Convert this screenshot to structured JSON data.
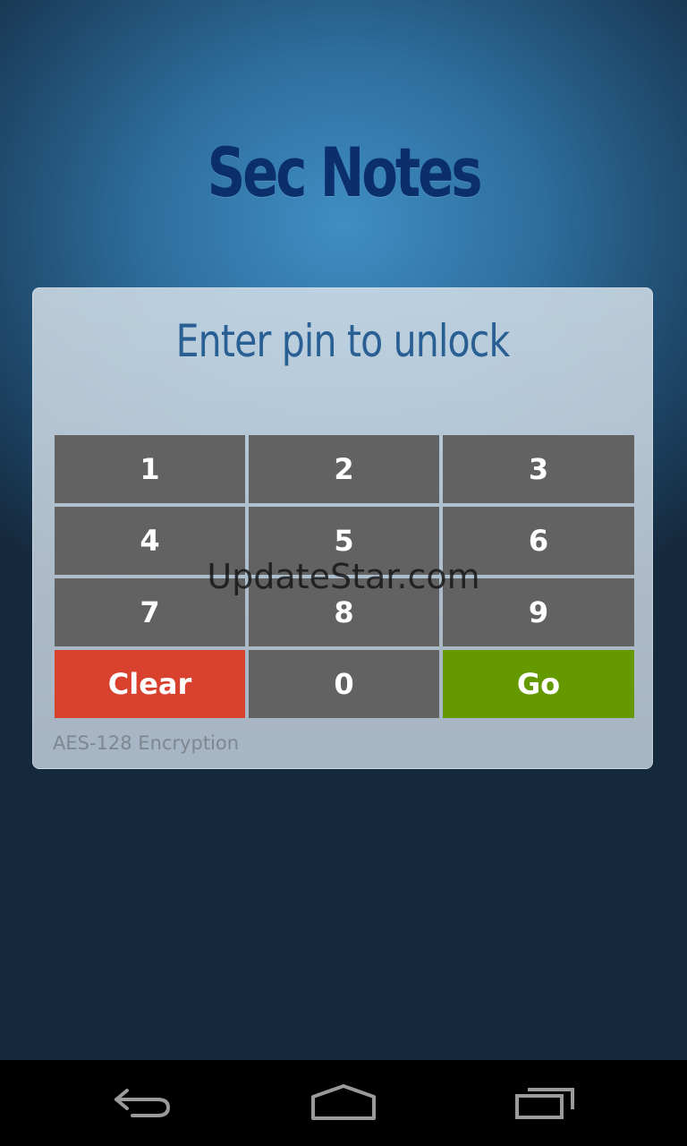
{
  "app": {
    "title": "Sec Notes"
  },
  "lock": {
    "prompt": "Enter pin to unlock",
    "keys": {
      "k1": "1",
      "k2": "2",
      "k3": "3",
      "k4": "4",
      "k5": "5",
      "k6": "6",
      "k7": "7",
      "k8": "8",
      "k9": "9",
      "clear": "Clear",
      "k0": "0",
      "go": "Go"
    },
    "encryption_label": "AES-128 Encryption"
  },
  "watermark": "UpdateStar.com",
  "colors": {
    "title": "#0b2f6b",
    "prompt": "#2a5f94",
    "key": "#626262",
    "clear": "#d9412f",
    "go": "#649a00"
  },
  "navbar": {
    "icons": [
      "back-icon",
      "home-icon",
      "recents-icon"
    ]
  }
}
